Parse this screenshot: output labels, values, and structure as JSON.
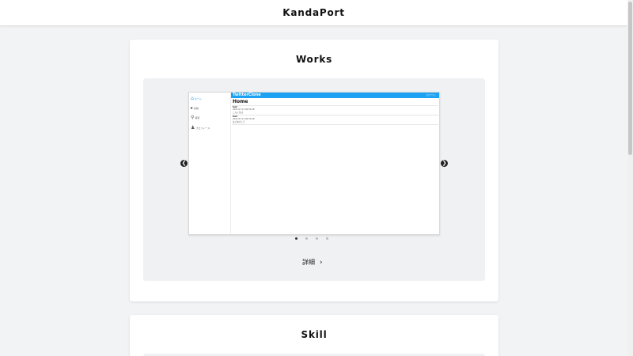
{
  "header": {
    "brand": "KandaPort"
  },
  "works": {
    "title": "Works",
    "slide": {
      "app_name": "TwitterClone",
      "header_meta": "ログアウト",
      "page_title": "Home",
      "sidebar": [
        {
          "label": "ホーム",
          "icon": "home-icon"
        },
        {
          "label": "投稿",
          "icon": "send-icon"
        },
        {
          "label": "検索",
          "icon": "search-icon"
        },
        {
          "label": "プロフィール",
          "icon": "user-icon"
        }
      ],
      "posts": [
        {
          "name": "test",
          "date": "2021-07-11 09:52:48",
          "body": "こんにちは"
        },
        {
          "name": "test",
          "date": "2021-07-11 09:51:08",
          "body": "はじめまして"
        }
      ]
    },
    "dots": 4,
    "active_dot": 0,
    "detail_label": "詳細",
    "prev_icon": "chevron-left-icon",
    "next_icon": "chevron-right-icon"
  },
  "skill": {
    "title": "Skill"
  },
  "colors": {
    "accent": "#1da1f2",
    "background": "#f2f3f5"
  }
}
